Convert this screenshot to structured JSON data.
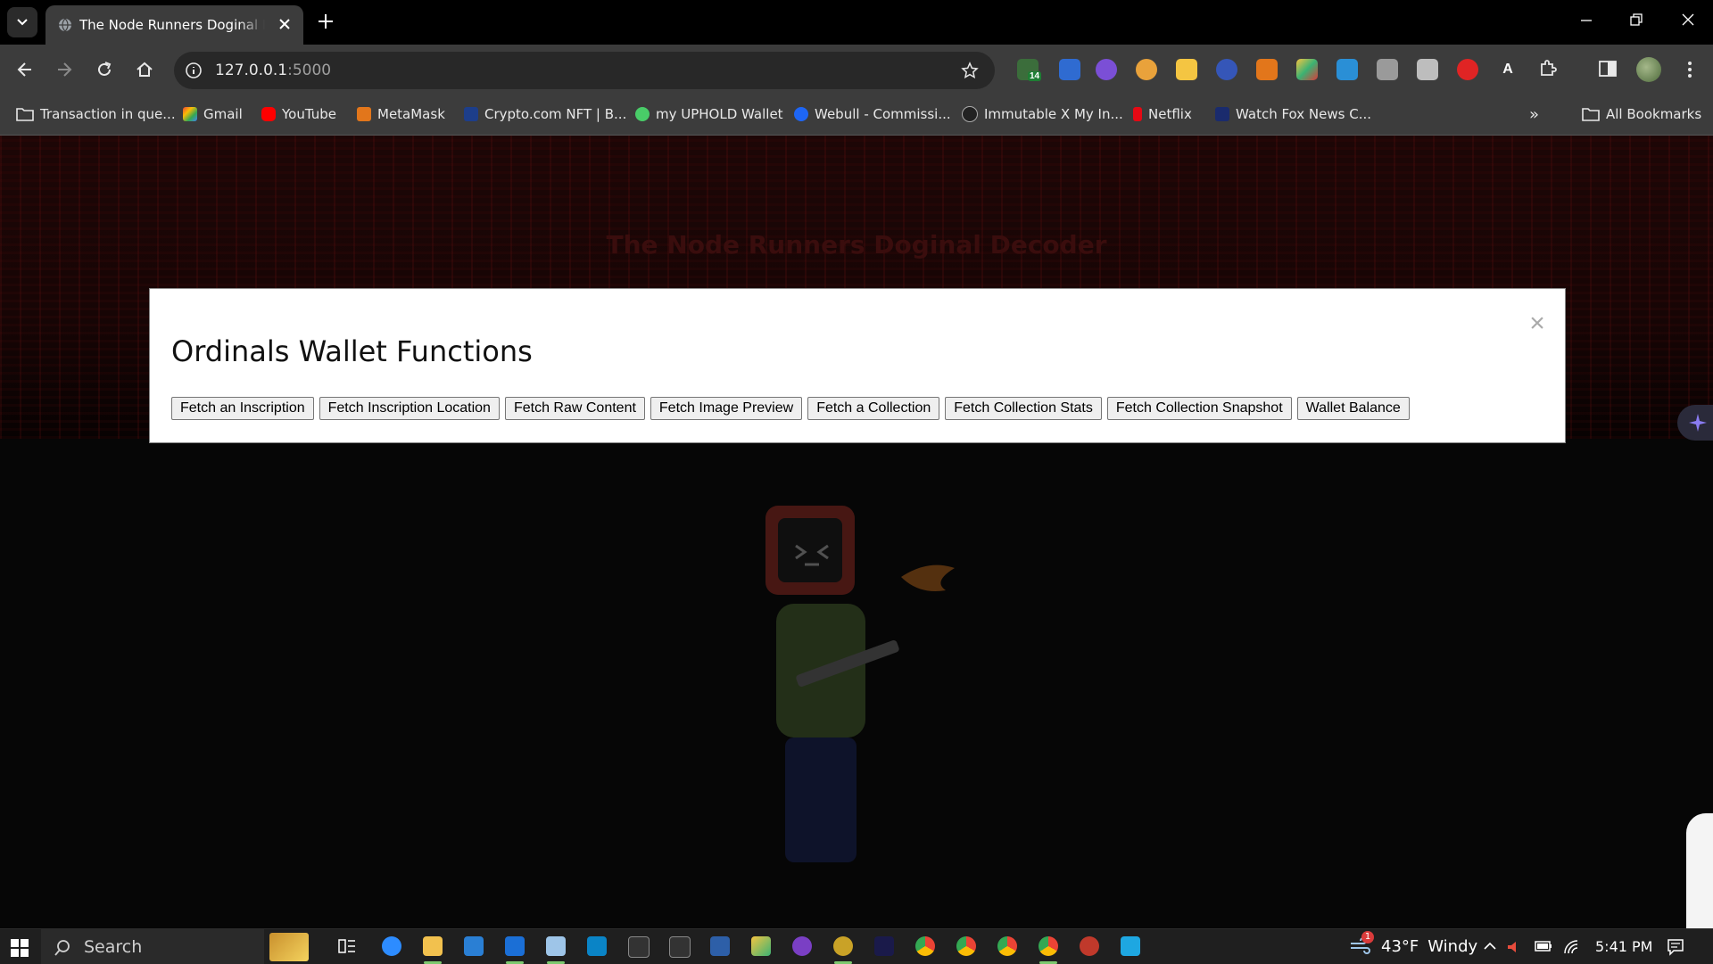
{
  "browser": {
    "tab_title": "The Node Runners Doginal Decoder",
    "url_host": "127.0.0.1",
    "url_port": ":5000",
    "extension_badge": "14",
    "bookmarks": [
      {
        "label": "Transaction in que...",
        "icon": "folder-icon"
      },
      {
        "label": "Gmail",
        "icon": "gmail-icon"
      },
      {
        "label": "YouTube",
        "icon": "youtube-icon"
      },
      {
        "label": "MetaMask",
        "icon": "metamask-icon"
      },
      {
        "label": "Crypto.com NFT | B...",
        "icon": "crypto-com-icon"
      },
      {
        "label": "my UPHOLD Wallet",
        "icon": "uphold-icon"
      },
      {
        "label": "Webull - Commissi...",
        "icon": "webull-icon"
      },
      {
        "label": "Immutable X My In...",
        "icon": "immutable-icon"
      },
      {
        "label": "Netflix",
        "icon": "netflix-icon"
      },
      {
        "label": "Watch Fox News C...",
        "icon": "fox-news-icon"
      }
    ],
    "all_bookmarks_label": "All Bookmarks"
  },
  "page": {
    "heading": "The Node Runners Doginal Decoder"
  },
  "modal": {
    "title": "Ordinals Wallet Functions",
    "close_symbol": "×",
    "buttons": [
      "Fetch an Inscription",
      "Fetch Inscription Location",
      "Fetch Raw Content",
      "Fetch Image Preview",
      "Fetch a Collection",
      "Fetch Collection Stats",
      "Fetch Collection Snapshot",
      "Wallet Balance"
    ]
  },
  "taskbar": {
    "search_placeholder": "Search",
    "weather_temp": "43°F",
    "weather_desc": "Windy",
    "weather_alert": "1",
    "time": "5:41 PM"
  }
}
